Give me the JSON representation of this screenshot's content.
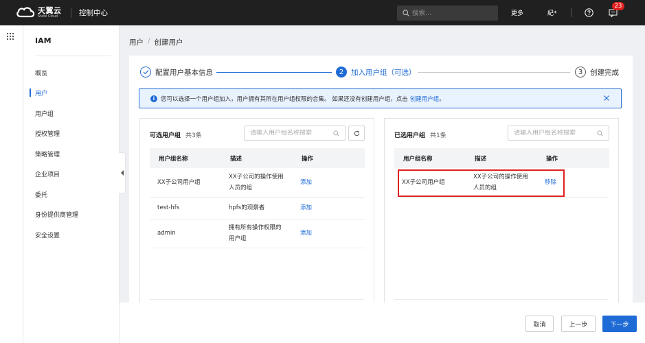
{
  "header": {
    "logo_cn": "天翼云",
    "logo_en": "State Cloud",
    "title": "控制中心",
    "search_placeholder": "搜索...",
    "more": "更多",
    "user": "紀*",
    "notification_count": "23"
  },
  "sidebar": {
    "title": "IAM",
    "items": [
      {
        "label": "概览"
      },
      {
        "label": "用户",
        "active": true
      },
      {
        "label": "用户组"
      },
      {
        "label": "授权管理"
      },
      {
        "label": "策略管理"
      },
      {
        "label": "企业项目"
      },
      {
        "label": "委托"
      },
      {
        "label": "身份提供商管理"
      },
      {
        "label": "安全设置"
      }
    ]
  },
  "breadcrumb": {
    "root": "用户",
    "separator": "/",
    "current": "创建用户"
  },
  "steps": [
    {
      "number": "",
      "label": "配置用户基本信息",
      "status": "done"
    },
    {
      "number": "2",
      "label": "加入用户组（可选）",
      "status": "active"
    },
    {
      "number": "3",
      "label": "创建完成",
      "status": "pending"
    }
  ],
  "info": {
    "text": "您可以选择一个用户组加入，用户拥有其所在用户组权限的合集。 如果还没有创建用户组，点击",
    "link": "创建用户组",
    "suffix": "。"
  },
  "left_panel": {
    "title": "可选用户组",
    "count": "共3条",
    "search_placeholder": "请输入用户组名称搜索",
    "columns": [
      "用户组名称",
      "描述",
      "操作"
    ],
    "rows": [
      {
        "name": "XX子公司用户组",
        "desc_line1": "XX子公司的操作使用",
        "desc_line2": "人员的组",
        "action": "添加"
      },
      {
        "name": "test-hfs",
        "desc_line1": "hpfs的观察者",
        "desc_line2": "",
        "action": "添加"
      },
      {
        "name": "admin",
        "desc_line1": "拥有所有操作权限的",
        "desc_line2": "用户组",
        "action": "添加"
      }
    ]
  },
  "right_panel": {
    "title": "已选用户组",
    "count": "共1条",
    "search_placeholder": "请输入用户组名称搜索",
    "columns": [
      "用户组名称",
      "描述",
      "操作"
    ],
    "rows": [
      {
        "name": "XX子公司用户组",
        "desc_line1": "XX子公司的操作使用",
        "desc_line2": "人员的组",
        "action": "移除"
      }
    ]
  },
  "footer": {
    "cancel": "取消",
    "prev": "上一步",
    "next": "下一步"
  },
  "colors": {
    "accent": "#1e6bd6",
    "topbar": "#202020",
    "highlight": "#e02020"
  }
}
